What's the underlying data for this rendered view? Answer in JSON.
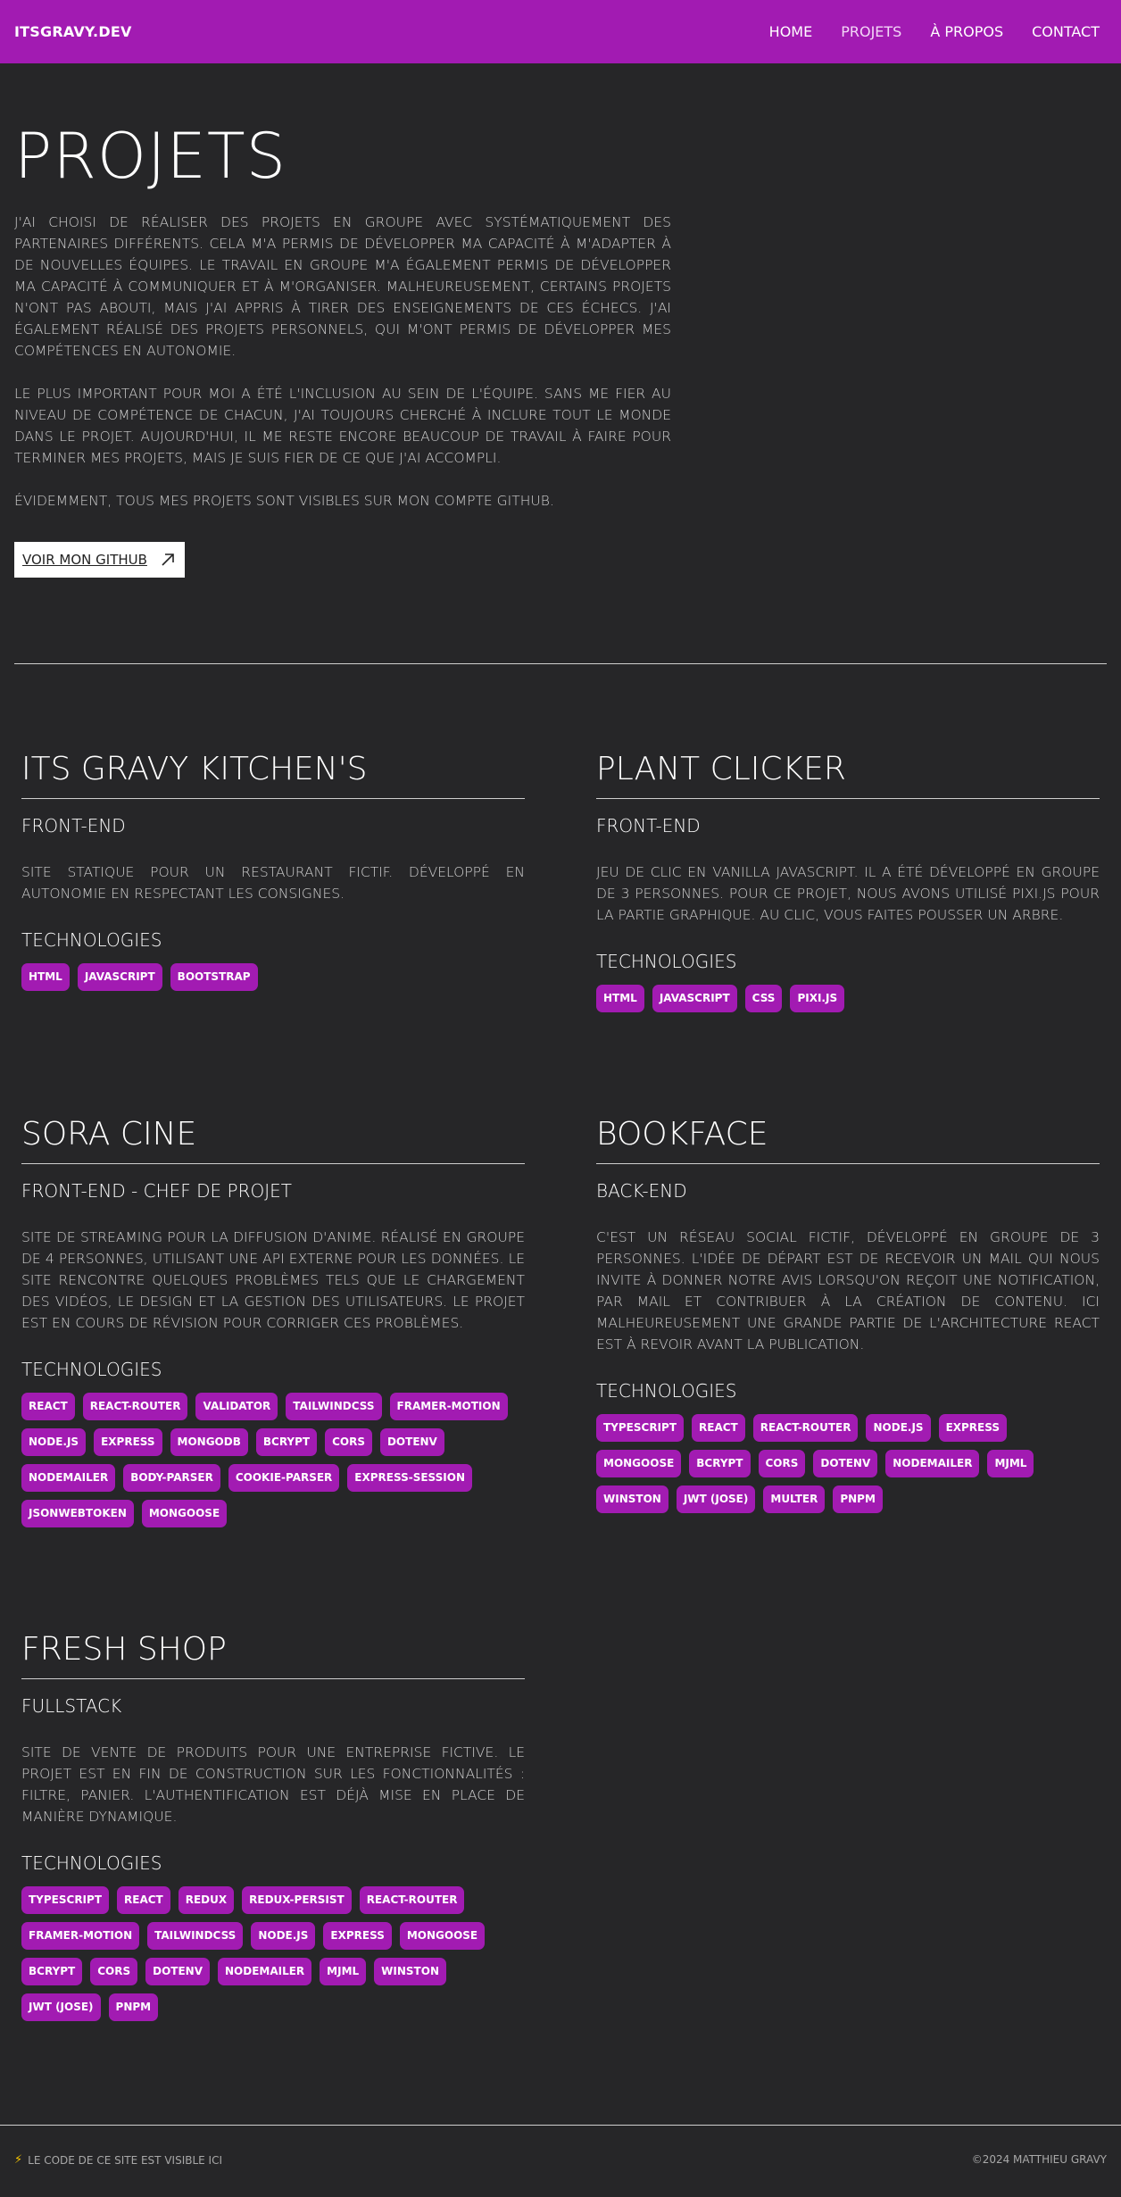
{
  "header": {
    "brand": "ITSGRAVY.DEV",
    "nav": [
      {
        "label": "HOME",
        "active": false
      },
      {
        "label": "PROJETS",
        "active": true
      },
      {
        "label": "À PROPOS",
        "active": false
      },
      {
        "label": "CONTACT",
        "active": false
      }
    ]
  },
  "intro": {
    "title": "PROJETS",
    "paragraphs": [
      "J'ai choisi de réaliser des projets en groupe avec systématiquement des partenaires différents. Cela m'a permis de développer ma capacité à m'adapter à de nouvelles équipes. Le travail en groupe m'a également permis de développer ma capacité à communiquer et à m'organiser. Malheureusement, certains projets n'ont pas abouti, mais j'ai appris à tirer des enseignements de ces échecs. J'ai également réalisé des projets personnels, qui m'ont permis de développer mes compétences en autonomie.",
      "Le plus important pour moi a été l'inclusion au sein de l'équipe. Sans me fier au niveau de compétence de chacun, j'ai toujours cherché à inclure tout le monde dans le projet. Aujourd'hui, il me reste encore beaucoup de travail à faire pour terminer mes projets, mais je suis fier de ce que j'ai accompli.",
      "Évidemment, tous mes projets sont visibles sur mon compte GitHub."
    ],
    "github_button": "VOIR MON GITHUB",
    "github_icon": "arrow-up-right-icon"
  },
  "projects": [
    {
      "title": "ITS GRAVY KITCHEN'S",
      "role": "FRONT-END",
      "description": "Site statique pour un restaurant fictif. Développé en autonomie en respectant les consignes.",
      "tech_title": "TECHNOLOGIES",
      "tags": [
        "HTML",
        "JAVASCRIPT",
        "BOOTSTRAP"
      ]
    },
    {
      "title": "PLANT CLICKER",
      "role": "FRONT-END",
      "description": "Jeu de clic en Vanilla JavaScript. Il a été développé en groupe de 3 personnes. Pour ce projet, nous avons utilisé Pixi.js pour la partie graphique. Au clic, vous faites pousser un arbre.",
      "tech_title": "TECHNOLOGIES",
      "tags": [
        "HTML",
        "JAVASCRIPT",
        "CSS",
        "PIXI.JS"
      ]
    },
    {
      "title": "SORA CINE",
      "role": "FRONT-END - CHEF DE PROJET",
      "description": "Site de streaming pour la diffusion d'anime. Réalisé en groupe de 4 personnes, utilisant une API externe pour les données. Le site rencontre quelques problèmes tels que le chargement des vidéos, le design et la gestion des utilisateurs. Le projet est en cours de révision pour corriger ces problèmes.",
      "tech_title": "TECHNOLOGIES",
      "tags": [
        "REACT",
        "REACT-ROUTER",
        "VALIDATOR",
        "TAILWINDCSS",
        "FRAMER-MOTION",
        "NODE.JS",
        "EXPRESS",
        "MONGODB",
        "BCRYPT",
        "CORS",
        "DOTENV",
        "NODEMAILER",
        "BODY-PARSER",
        "COOKIE-PARSER",
        "EXPRESS-SESSION",
        "JSONWEBTOKEN",
        "MONGOOSE"
      ]
    },
    {
      "title": "BOOKFACE",
      "role": "BACK-END",
      "description": "C'est un réseau social fictif, développé en groupe de 3 personnes. L'idée de départ est de recevoir un mail qui nous invite à donner notre avis lorsqu'on reçoit une notification, par mail et contribuer à la création de contenu. Ici malheureusement une grande partie de l'architecture React est à revoir avant la publication.",
      "tech_title": "TECHNOLOGIES",
      "tags": [
        "TYPESCRIPT",
        "REACT",
        "REACT-ROUTER",
        "NODE.JS",
        "EXPRESS",
        "MONGOOSE",
        "BCRYPT",
        "CORS",
        "DOTENV",
        "NODEMAILER",
        "MJML",
        "WINSTON",
        "JWT (JOSE)",
        "MULTER",
        "PNPM"
      ]
    },
    {
      "title": "FRESH SHOP",
      "role": "FULLSTACK",
      "description": "Site de vente de produits pour une entreprise fictive. Le projet est en fin de construction sur les fonctionnalités : filtre, panier. L'authentification est déjà mise en place de manière dynamique.",
      "tech_title": "TECHNOLOGIES",
      "tags": [
        "TYPESCRIPT",
        "REACT",
        "REDUX",
        "REDUX-PERSIST",
        "REACT-ROUTER",
        "FRAMER-MOTION",
        "TAILWINDCSS",
        "NODE.JS",
        "EXPRESS",
        "MONGOOSE",
        "BCRYPT",
        "CORS",
        "DOTENV",
        "NODEMAILER",
        "MJML",
        "WINSTON",
        "JWT (JOSE)",
        "PNPM"
      ]
    }
  ],
  "footer": {
    "left_icon": "lightning-icon",
    "left_text": "LE CODE DE CE SITE EST VISIBLE ICI",
    "right_text": "©2024  MATTHIEU GRAVY"
  },
  "colors": {
    "accent": "#a21bb2",
    "background": "#262628",
    "text": "#d9d9d9"
  }
}
